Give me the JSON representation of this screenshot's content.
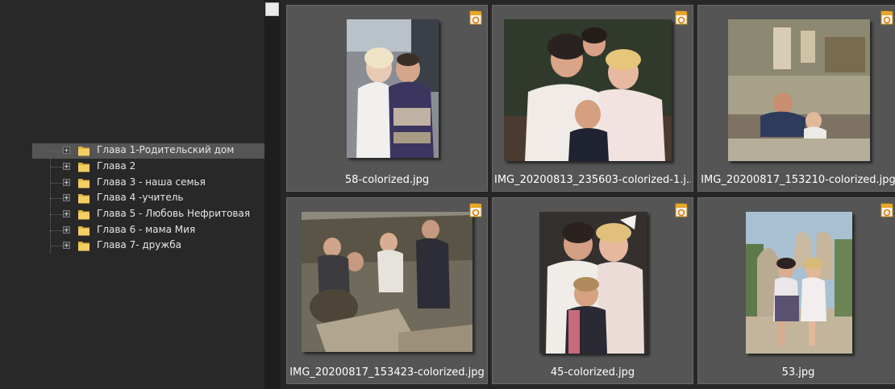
{
  "tree": {
    "items": [
      {
        "label": "Глава 1-Родительский дом",
        "selected": true
      },
      {
        "label": "Глава 2"
      },
      {
        "label": "Глава 3 - наша семья"
      },
      {
        "label": "Глава 4 -учитель"
      },
      {
        "label": "Глава 5 - Любовь Нефритовая"
      },
      {
        "label": "Глава 6 - мама Мия"
      },
      {
        "label": "Глава 7- дружба"
      }
    ]
  },
  "thumbnails": [
    {
      "filename": "58-colorized.jpg",
      "badge": "zip-icon"
    },
    {
      "filename": "IMG_20200813_235603-colorized-1.j...",
      "badge": "zip-icon"
    },
    {
      "filename": "IMG_20200817_153210-colorized.jpg",
      "badge": "zip-icon"
    },
    {
      "filename": "IMG_20200817_153423-colorized.jpg",
      "badge": "zip-icon"
    },
    {
      "filename": "45-colorized.jpg",
      "badge": "zip-icon"
    },
    {
      "filename": "53.jpg",
      "badge": "zip-icon"
    }
  ],
  "colors": {
    "selection": "#555555",
    "panel": "#555555",
    "badge": "#f0a020"
  }
}
